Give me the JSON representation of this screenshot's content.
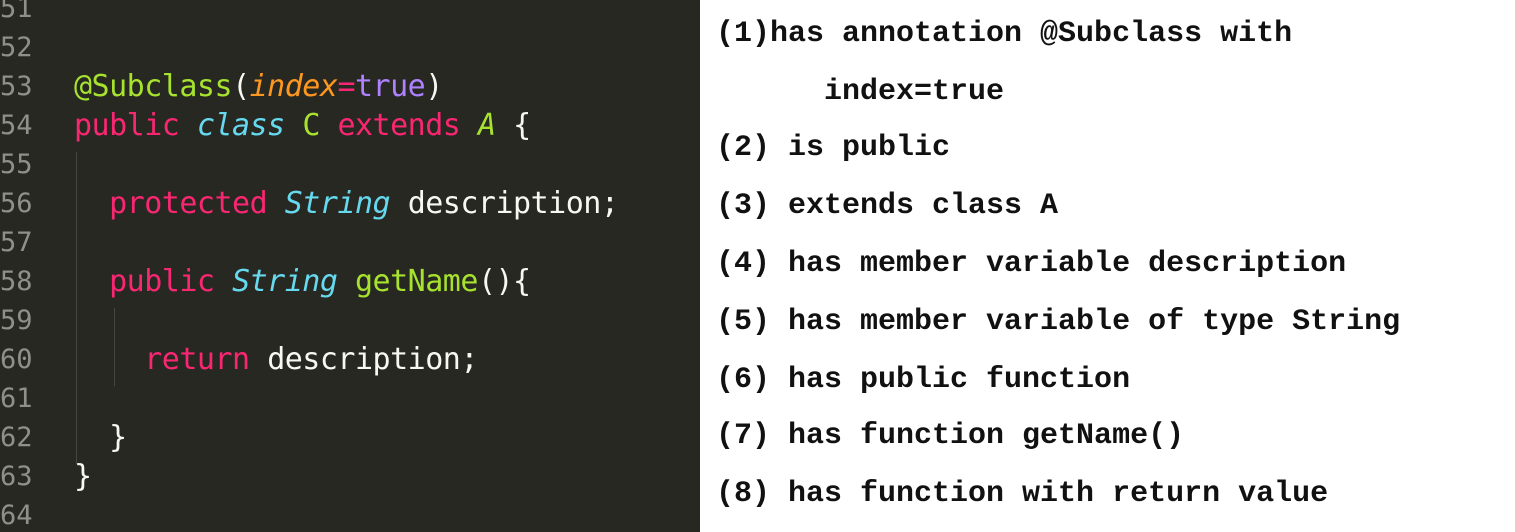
{
  "editor": {
    "theme_colors": {
      "background": "#272822",
      "gutter_text": "#8f908a",
      "keyword": "#f92672",
      "type": "#66d9ef",
      "function": "#a6e22e",
      "parameter": "#fd971f",
      "boolean": "#ae81ff",
      "plain": "#f8f8f2"
    },
    "lines": [
      {
        "number": "51",
        "tokens": []
      },
      {
        "number": "52",
        "tokens": []
      },
      {
        "number": "53",
        "tokens": [
          {
            "text": "@Subclass",
            "kind": "annot"
          },
          {
            "text": "(",
            "kind": "plain"
          },
          {
            "text": "index",
            "kind": "param"
          },
          {
            "text": "=",
            "kind": "op"
          },
          {
            "text": "true",
            "kind": "bool"
          },
          {
            "text": ")",
            "kind": "plain"
          }
        ]
      },
      {
        "number": "54",
        "tokens": [
          {
            "text": "public ",
            "kind": "kw"
          },
          {
            "text": "class ",
            "kind": "type"
          },
          {
            "text": "C ",
            "kind": "class"
          },
          {
            "text": "extends ",
            "kind": "kw"
          },
          {
            "text": "A ",
            "kind": "super"
          },
          {
            "text": "{",
            "kind": "plain"
          }
        ]
      },
      {
        "number": "55",
        "tokens": []
      },
      {
        "number": "56",
        "tokens": [
          {
            "text": "  protected ",
            "kind": "kw"
          },
          {
            "text": "String ",
            "kind": "type"
          },
          {
            "text": "description;",
            "kind": "plain"
          }
        ]
      },
      {
        "number": "57",
        "tokens": []
      },
      {
        "number": "58",
        "tokens": [
          {
            "text": "  public ",
            "kind": "kw"
          },
          {
            "text": "String ",
            "kind": "type"
          },
          {
            "text": "getName",
            "kind": "fn"
          },
          {
            "text": "(){",
            "kind": "plain"
          }
        ]
      },
      {
        "number": "59",
        "tokens": []
      },
      {
        "number": "60",
        "tokens": [
          {
            "text": "    return ",
            "kind": "kw"
          },
          {
            "text": "description;",
            "kind": "plain"
          }
        ]
      },
      {
        "number": "61",
        "tokens": []
      },
      {
        "number": "62",
        "tokens": [
          {
            "text": "  }",
            "kind": "plain"
          }
        ]
      },
      {
        "number": "63",
        "tokens": [
          {
            "text": "}",
            "kind": "plain"
          }
        ]
      },
      {
        "number": "64",
        "tokens": []
      }
    ]
  },
  "features": [
    "(1)has annotation @Subclass with",
    "      index=true",
    "(2) is public",
    "(3) extends class A",
    "(4) has member variable description",
    "(5) has member variable of type String",
    "(6) has public function",
    "(7) has function getName()",
    "(8) has function with return value"
  ]
}
